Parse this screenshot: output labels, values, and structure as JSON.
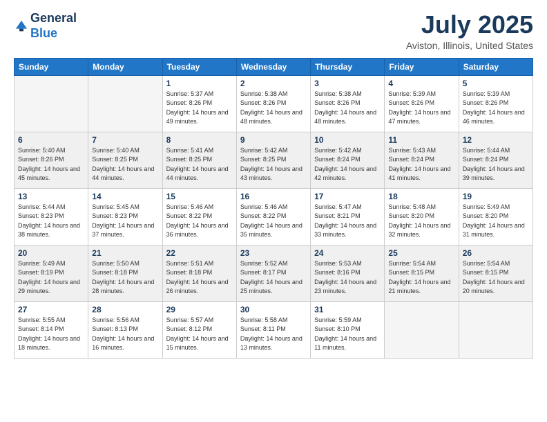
{
  "logo": {
    "general": "General",
    "blue": "Blue"
  },
  "header": {
    "month": "July 2025",
    "location": "Aviston, Illinois, United States"
  },
  "weekdays": [
    "Sunday",
    "Monday",
    "Tuesday",
    "Wednesday",
    "Thursday",
    "Friday",
    "Saturday"
  ],
  "weeks": [
    [
      {
        "day": "",
        "empty": true
      },
      {
        "day": "",
        "empty": true
      },
      {
        "day": "1",
        "sunrise": "Sunrise: 5:37 AM",
        "sunset": "Sunset: 8:26 PM",
        "daylight": "Daylight: 14 hours and 49 minutes."
      },
      {
        "day": "2",
        "sunrise": "Sunrise: 5:38 AM",
        "sunset": "Sunset: 8:26 PM",
        "daylight": "Daylight: 14 hours and 48 minutes."
      },
      {
        "day": "3",
        "sunrise": "Sunrise: 5:38 AM",
        "sunset": "Sunset: 8:26 PM",
        "daylight": "Daylight: 14 hours and 48 minutes."
      },
      {
        "day": "4",
        "sunrise": "Sunrise: 5:39 AM",
        "sunset": "Sunset: 8:26 PM",
        "daylight": "Daylight: 14 hours and 47 minutes."
      },
      {
        "day": "5",
        "sunrise": "Sunrise: 5:39 AM",
        "sunset": "Sunset: 8:26 PM",
        "daylight": "Daylight: 14 hours and 46 minutes."
      }
    ],
    [
      {
        "day": "6",
        "sunrise": "Sunrise: 5:40 AM",
        "sunset": "Sunset: 8:26 PM",
        "daylight": "Daylight: 14 hours and 45 minutes."
      },
      {
        "day": "7",
        "sunrise": "Sunrise: 5:40 AM",
        "sunset": "Sunset: 8:25 PM",
        "daylight": "Daylight: 14 hours and 44 minutes."
      },
      {
        "day": "8",
        "sunrise": "Sunrise: 5:41 AM",
        "sunset": "Sunset: 8:25 PM",
        "daylight": "Daylight: 14 hours and 44 minutes."
      },
      {
        "day": "9",
        "sunrise": "Sunrise: 5:42 AM",
        "sunset": "Sunset: 8:25 PM",
        "daylight": "Daylight: 14 hours and 43 minutes."
      },
      {
        "day": "10",
        "sunrise": "Sunrise: 5:42 AM",
        "sunset": "Sunset: 8:24 PM",
        "daylight": "Daylight: 14 hours and 42 minutes."
      },
      {
        "day": "11",
        "sunrise": "Sunrise: 5:43 AM",
        "sunset": "Sunset: 8:24 PM",
        "daylight": "Daylight: 14 hours and 41 minutes."
      },
      {
        "day": "12",
        "sunrise": "Sunrise: 5:44 AM",
        "sunset": "Sunset: 8:24 PM",
        "daylight": "Daylight: 14 hours and 39 minutes."
      }
    ],
    [
      {
        "day": "13",
        "sunrise": "Sunrise: 5:44 AM",
        "sunset": "Sunset: 8:23 PM",
        "daylight": "Daylight: 14 hours and 38 minutes."
      },
      {
        "day": "14",
        "sunrise": "Sunrise: 5:45 AM",
        "sunset": "Sunset: 8:23 PM",
        "daylight": "Daylight: 14 hours and 37 minutes."
      },
      {
        "day": "15",
        "sunrise": "Sunrise: 5:46 AM",
        "sunset": "Sunset: 8:22 PM",
        "daylight": "Daylight: 14 hours and 36 minutes."
      },
      {
        "day": "16",
        "sunrise": "Sunrise: 5:46 AM",
        "sunset": "Sunset: 8:22 PM",
        "daylight": "Daylight: 14 hours and 35 minutes."
      },
      {
        "day": "17",
        "sunrise": "Sunrise: 5:47 AM",
        "sunset": "Sunset: 8:21 PM",
        "daylight": "Daylight: 14 hours and 33 minutes."
      },
      {
        "day": "18",
        "sunrise": "Sunrise: 5:48 AM",
        "sunset": "Sunset: 8:20 PM",
        "daylight": "Daylight: 14 hours and 32 minutes."
      },
      {
        "day": "19",
        "sunrise": "Sunrise: 5:49 AM",
        "sunset": "Sunset: 8:20 PM",
        "daylight": "Daylight: 14 hours and 31 minutes."
      }
    ],
    [
      {
        "day": "20",
        "sunrise": "Sunrise: 5:49 AM",
        "sunset": "Sunset: 8:19 PM",
        "daylight": "Daylight: 14 hours and 29 minutes."
      },
      {
        "day": "21",
        "sunrise": "Sunrise: 5:50 AM",
        "sunset": "Sunset: 8:18 PM",
        "daylight": "Daylight: 14 hours and 28 minutes."
      },
      {
        "day": "22",
        "sunrise": "Sunrise: 5:51 AM",
        "sunset": "Sunset: 8:18 PM",
        "daylight": "Daylight: 14 hours and 26 minutes."
      },
      {
        "day": "23",
        "sunrise": "Sunrise: 5:52 AM",
        "sunset": "Sunset: 8:17 PM",
        "daylight": "Daylight: 14 hours and 25 minutes."
      },
      {
        "day": "24",
        "sunrise": "Sunrise: 5:53 AM",
        "sunset": "Sunset: 8:16 PM",
        "daylight": "Daylight: 14 hours and 23 minutes."
      },
      {
        "day": "25",
        "sunrise": "Sunrise: 5:54 AM",
        "sunset": "Sunset: 8:15 PM",
        "daylight": "Daylight: 14 hours and 21 minutes."
      },
      {
        "day": "26",
        "sunrise": "Sunrise: 5:54 AM",
        "sunset": "Sunset: 8:15 PM",
        "daylight": "Daylight: 14 hours and 20 minutes."
      }
    ],
    [
      {
        "day": "27",
        "sunrise": "Sunrise: 5:55 AM",
        "sunset": "Sunset: 8:14 PM",
        "daylight": "Daylight: 14 hours and 18 minutes."
      },
      {
        "day": "28",
        "sunrise": "Sunrise: 5:56 AM",
        "sunset": "Sunset: 8:13 PM",
        "daylight": "Daylight: 14 hours and 16 minutes."
      },
      {
        "day": "29",
        "sunrise": "Sunrise: 5:57 AM",
        "sunset": "Sunset: 8:12 PM",
        "daylight": "Daylight: 14 hours and 15 minutes."
      },
      {
        "day": "30",
        "sunrise": "Sunrise: 5:58 AM",
        "sunset": "Sunset: 8:11 PM",
        "daylight": "Daylight: 14 hours and 13 minutes."
      },
      {
        "day": "31",
        "sunrise": "Sunrise: 5:59 AM",
        "sunset": "Sunset: 8:10 PM",
        "daylight": "Daylight: 14 hours and 11 minutes."
      },
      {
        "day": "",
        "empty": true
      },
      {
        "day": "",
        "empty": true
      }
    ]
  ]
}
